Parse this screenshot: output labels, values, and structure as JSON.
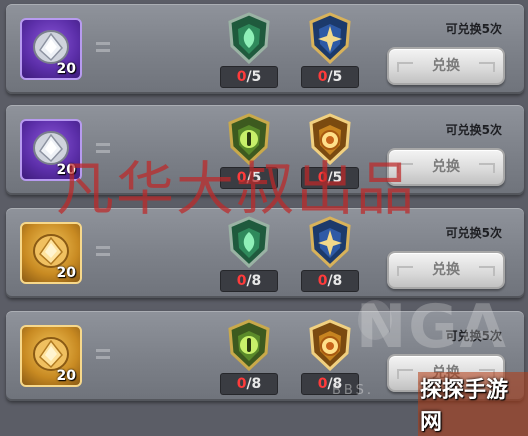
{
  "rows": [
    {
      "item_count": "20",
      "item_color": "purple",
      "badge1_type": "green-leaf-icon",
      "badge2_type": "blue-star-icon",
      "prog1_cur": "0",
      "prog1_max": "/5",
      "prog2_cur": "0",
      "prog2_max": "/5",
      "avail_text": "可兑换5次",
      "btn_label": "兑换"
    },
    {
      "item_count": "20",
      "item_color": "purple",
      "badge1_type": "green-eye-icon",
      "badge2_type": "gold-sun-icon",
      "prog1_cur": "0",
      "prog1_max": "/5",
      "prog2_cur": "0",
      "prog2_max": "/5",
      "avail_text": "可兑换5次",
      "btn_label": "兑换"
    },
    {
      "item_count": "20",
      "item_color": "gold",
      "badge1_type": "green-leaf-icon",
      "badge2_type": "blue-star-icon",
      "prog1_cur": "0",
      "prog1_max": "/8",
      "prog2_cur": "0",
      "prog2_max": "/8",
      "avail_text": "可兑换5次",
      "btn_label": "兑换"
    },
    {
      "item_count": "20",
      "item_color": "gold",
      "badge1_type": "green-eye-icon",
      "badge2_type": "gold-sun-icon",
      "prog1_cur": "0",
      "prog1_max": "/8",
      "prog2_cur": "0",
      "prog2_max": "/8",
      "avail_text": "可兑换5次",
      "btn_label": "兑换"
    }
  ],
  "watermark": "凡华大叔出品",
  "nga_logo": "NGA",
  "bbs_text": "BBS.",
  "corner_logo": "探探手游网",
  "colors": {
    "progress_current": "#ff3b3b",
    "purple_frame": "#5b2ea8",
    "gold_frame": "#c88a22"
  }
}
